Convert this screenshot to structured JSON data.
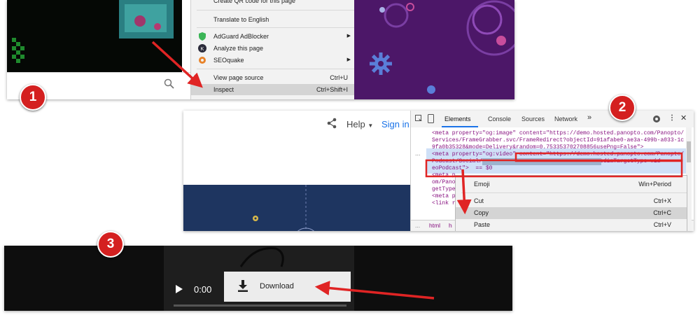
{
  "steps": {
    "one": "1",
    "two": "2",
    "three": "3"
  },
  "browser_menu": {
    "items": [
      {
        "label": "Create QR code for this page",
        "shortcut": ""
      },
      {
        "label": "Translate to English",
        "shortcut": ""
      },
      {
        "label": "AdGuard AdBlocker",
        "shortcut": ""
      },
      {
        "label": "Analyze this page",
        "shortcut": ""
      },
      {
        "label": "SEOquake",
        "shortcut": ""
      },
      {
        "label": "View page source",
        "shortcut": "Ctrl+U"
      },
      {
        "label": "Inspect",
        "shortcut": "Ctrl+Shift+I"
      }
    ]
  },
  "site_header": {
    "help": "Help",
    "sign_in": "Sign in"
  },
  "devtools": {
    "tabs": [
      "Elements",
      "Console",
      "Sources",
      "Network"
    ],
    "more": "»",
    "code_lines": [
      "<meta property=\"og:image\" content=\"https://demo.hosted.panopto.com/Panopto/",
      "Services/FrameGrabber.svc/FrameRedirect?objectId=91afabe0-ae3a-499b-a033-1c",
      "9fa0b35328&mode=Delivery&random=0.753353702708856usePng=False\">",
      "<meta property=\"og:video\" content=\"https://demo.hosted.panopto.com/Panopto/",
      "Podcast/Social/                             .mp4?mediaTargetType=vid",
      "eoPodcast\">  == $0",
      "<meta p",
      "om/Pano",
      "getType",
      "<meta p",
      "<link r"
    ],
    "bottom_tab": "html",
    "bottom_tab2": "h",
    "dots": "..."
  },
  "copy_menu": {
    "items": [
      {
        "label": "Emoji",
        "shortcut": "Win+Period"
      },
      {
        "label": "Cut",
        "shortcut": "Ctrl+X"
      },
      {
        "label": "Copy",
        "shortcut": "Ctrl+C"
      },
      {
        "label": "Paste",
        "shortcut": "Ctrl+V"
      }
    ]
  },
  "player": {
    "time": "0:00",
    "download": "Download"
  },
  "colors": {
    "accent_red": "#d42020",
    "link_blue": "#1a73e8",
    "menu_highlight": "#d4d4d4"
  }
}
